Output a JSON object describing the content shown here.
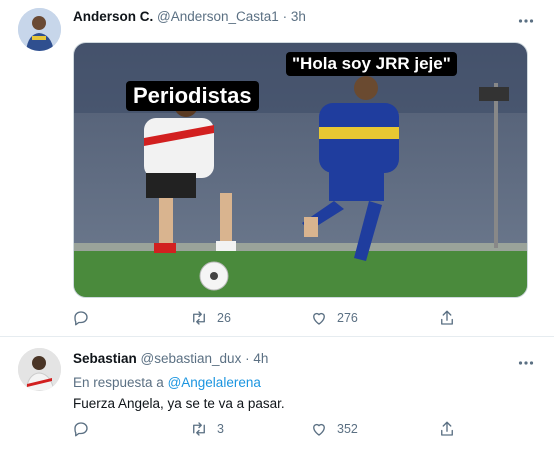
{
  "tweets": [
    {
      "name": "Anderson C.",
      "handle": "@Anderson_Casta1",
      "separator": "·",
      "time": "3h",
      "media_captions": [
        "Periodistas",
        "\"Hola soy JRR jeje\""
      ],
      "actions": {
        "reply": "",
        "retweet": "26",
        "like": "276"
      }
    },
    {
      "name": "Sebastian",
      "handle": "@sebastian_dux",
      "separator": "·",
      "time": "4h",
      "reply_prefix": "En respuesta a",
      "reply_mention": "@Angelalerena",
      "text": "Fuerza Angela, ya se te va a pasar.",
      "actions": {
        "reply": "",
        "retweet": "3",
        "like": "352"
      }
    }
  ],
  "colors": {
    "secondary": "#5b7083",
    "link": "#1b95e0",
    "divider": "#e6ecf0"
  },
  "icons": [
    "more-icon",
    "reply-icon",
    "retweet-icon",
    "like-icon",
    "share-icon"
  ]
}
